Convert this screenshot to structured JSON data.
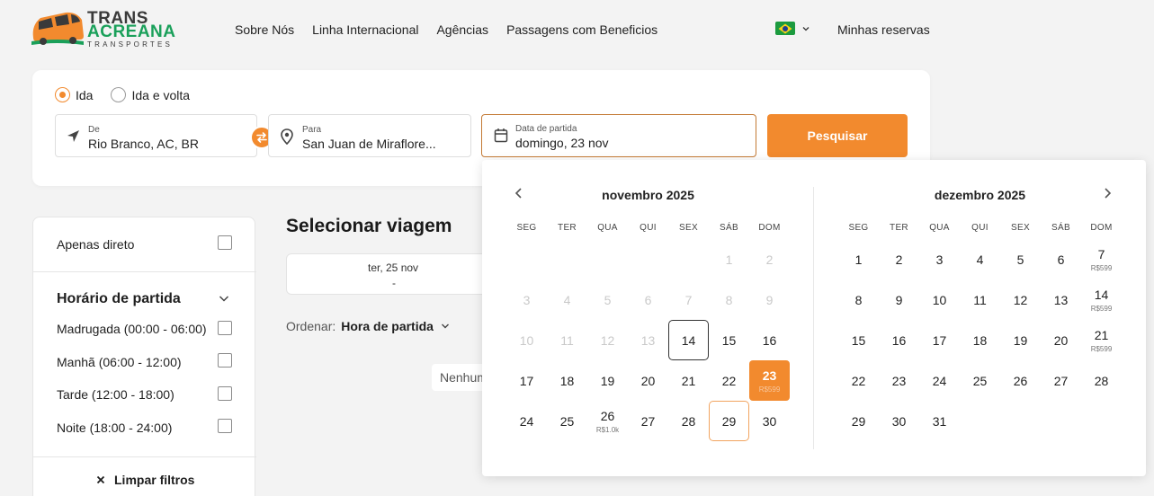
{
  "brand": {
    "line1": "TRANS",
    "line2": "ACREANA",
    "line3": "TRANSPORTES",
    "accent": "#f28a2e",
    "green": "#1aa05a"
  },
  "nav": [
    "Sobre Nós",
    "Linha Internacional",
    "Agências",
    "Passagens com Beneficios"
  ],
  "header": {
    "flag_icon": "brazil-flag-icon",
    "my_bookings": "Minhas reservas"
  },
  "search": {
    "trip_types": [
      {
        "label": "Ida",
        "selected": true
      },
      {
        "label": "Ida e volta",
        "selected": false
      }
    ],
    "from": {
      "label": "De",
      "value": "Rio Branco, AC, BR"
    },
    "to": {
      "label": "Para",
      "value": "San Juan de Miraflore..."
    },
    "date": {
      "label": "Data de partida",
      "value": "domingo, 23 nov"
    },
    "button": "Pesquisar"
  },
  "filters": {
    "direct_only": "Apenas direto",
    "departure_title": "Horário de partida",
    "options": [
      "Madrugada (00:00 - 06:00)",
      "Manhã (06:00 - 12:00)",
      "Tarde (12:00 - 18:00)",
      "Noite (18:00 - 24:00)"
    ],
    "clear": "Limpar filtros"
  },
  "main": {
    "title": "Selecionar viagem",
    "date_card": {
      "date": "ter, 25 nov",
      "price": "-"
    },
    "order_label": "Ordenar:",
    "order_value": "Hora de partida",
    "empty_text": "Nenhum"
  },
  "calendar": {
    "weekdays": [
      "SEG",
      "TER",
      "QUA",
      "QUI",
      "SEX",
      "SÁB",
      "DOM"
    ],
    "months": [
      {
        "title": "novembro 2025",
        "offset": 5,
        "days": 30,
        "disabled_until": 13,
        "today": 14,
        "selected": 23,
        "hover": 29,
        "prices": {
          "23": "R$599",
          "26": "R$1.0k"
        }
      },
      {
        "title": "dezembro 2025",
        "offset": 0,
        "days": 31,
        "disabled_until": 0,
        "today": 0,
        "selected": 0,
        "hover": 0,
        "prices": {
          "7": "R$599",
          "14": "R$599",
          "21": "R$599"
        }
      }
    ]
  }
}
